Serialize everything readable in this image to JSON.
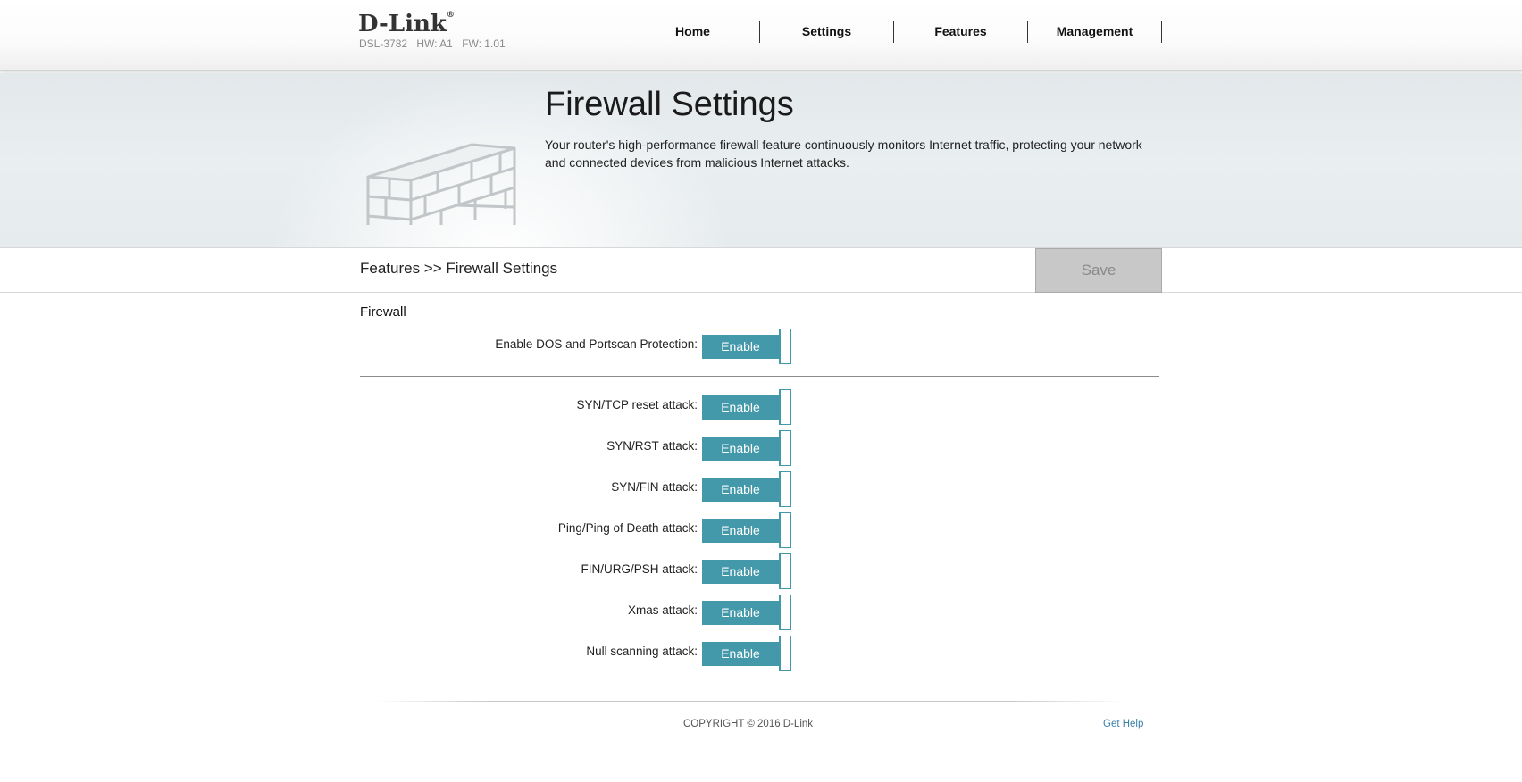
{
  "brand": {
    "logo": "D-Link",
    "logo_reg": "®",
    "model": "DSL-3782",
    "hw": "HW: A1",
    "fw": "FW: 1.01"
  },
  "nav": {
    "items": [
      {
        "label": "Home"
      },
      {
        "label": "Settings"
      },
      {
        "label": "Features"
      },
      {
        "label": "Management"
      }
    ]
  },
  "banner": {
    "title": "Firewall Settings",
    "description": "Your router's high-performance firewall feature continuously monitors Internet traffic, protecting your network and connected devices from malicious Internet attacks.",
    "icon": "brick-wall-icon"
  },
  "breadcrumb": "Features >> Firewall Settings",
  "save_label": "Save",
  "form": {
    "section_title": "Firewall",
    "dos": {
      "label": "Enable DOS and Portscan Protection:",
      "state": "Enable"
    },
    "attacks": [
      {
        "label": "SYN/TCP reset attack:",
        "state": "Enable"
      },
      {
        "label": "SYN/RST attack:",
        "state": "Enable"
      },
      {
        "label": "SYN/FIN attack:",
        "state": "Enable"
      },
      {
        "label": "Ping/Ping of Death attack:",
        "state": "Enable"
      },
      {
        "label": "FIN/URG/PSH attack:",
        "state": "Enable"
      },
      {
        "label": "Xmas attack:",
        "state": "Enable"
      },
      {
        "label": "Null scanning attack:",
        "state": "Enable"
      }
    ]
  },
  "footer": {
    "copyright": "COPYRIGHT © 2016 D-Link",
    "help": "Get Help"
  },
  "colors": {
    "accent": "#4398a9",
    "save_bg": "#c8c8c8"
  }
}
